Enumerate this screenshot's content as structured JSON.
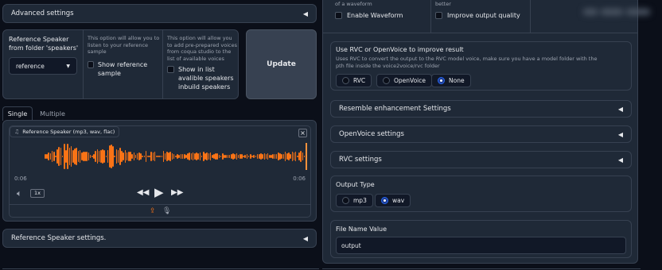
{
  "left": {
    "advanced_settings": "Advanced settings",
    "ref_speaker_label": "Reference Speaker from folder 'speakers'",
    "ref_speaker_value": "reference",
    "show_ref_desc": "This option will allow you to listen to your reference sample",
    "show_ref_label": "Show reference sample",
    "show_inbuild_desc": "This option will allow you to add pre-prepared voices from coqua studio to the list of available voices",
    "show_inbuild_label": "Show in list avalible speakers inbuild speakers",
    "update_button": "Update",
    "tabs": [
      "Single",
      "Multiple"
    ],
    "audio_label": "Reference Speaker (mp3, wav, flac)",
    "time_current": "0:06",
    "time_total": "0:06",
    "speed": "1x",
    "ref_settings": "Reference Speaker settings."
  },
  "right": {
    "waveform_desc": "of a waveform",
    "waveform_label": "Enable Waveform",
    "quality_desc": "better",
    "quality_label": "Improve output quality",
    "rvc_title": "Use RVC or OpenVoice to improve result",
    "rvc_desc": "Uses RVC to convert the output to the RVC model voice, make sure you have a model folder with the pth file inside the voice2voice/rvc folder",
    "rvc_options": [
      "RVC",
      "OpenVoice",
      "None"
    ],
    "rvc_selected": "None",
    "resemble": "Resemble enhancement Settings",
    "openvoice": "OpenVoice settings",
    "rvc_settings": "RVC settings",
    "output_type_label": "Output Type",
    "output_options": [
      "mp3",
      "wav"
    ],
    "output_selected": "wav",
    "file_name_label": "File Name Value",
    "file_name_value": "output"
  },
  "colors": {
    "background": "#0b0f19",
    "panel": "#1f2937",
    "border": "#374151",
    "accent_orange": "#f97316",
    "radio_blue": "#2563eb"
  },
  "icons": [
    "triangle-left-icon",
    "music-note-icon",
    "close-icon",
    "volume-icon",
    "rewind-icon",
    "play-icon",
    "forward-icon",
    "upload-icon",
    "microphone-icon",
    "dropdown-caret-icon"
  ]
}
